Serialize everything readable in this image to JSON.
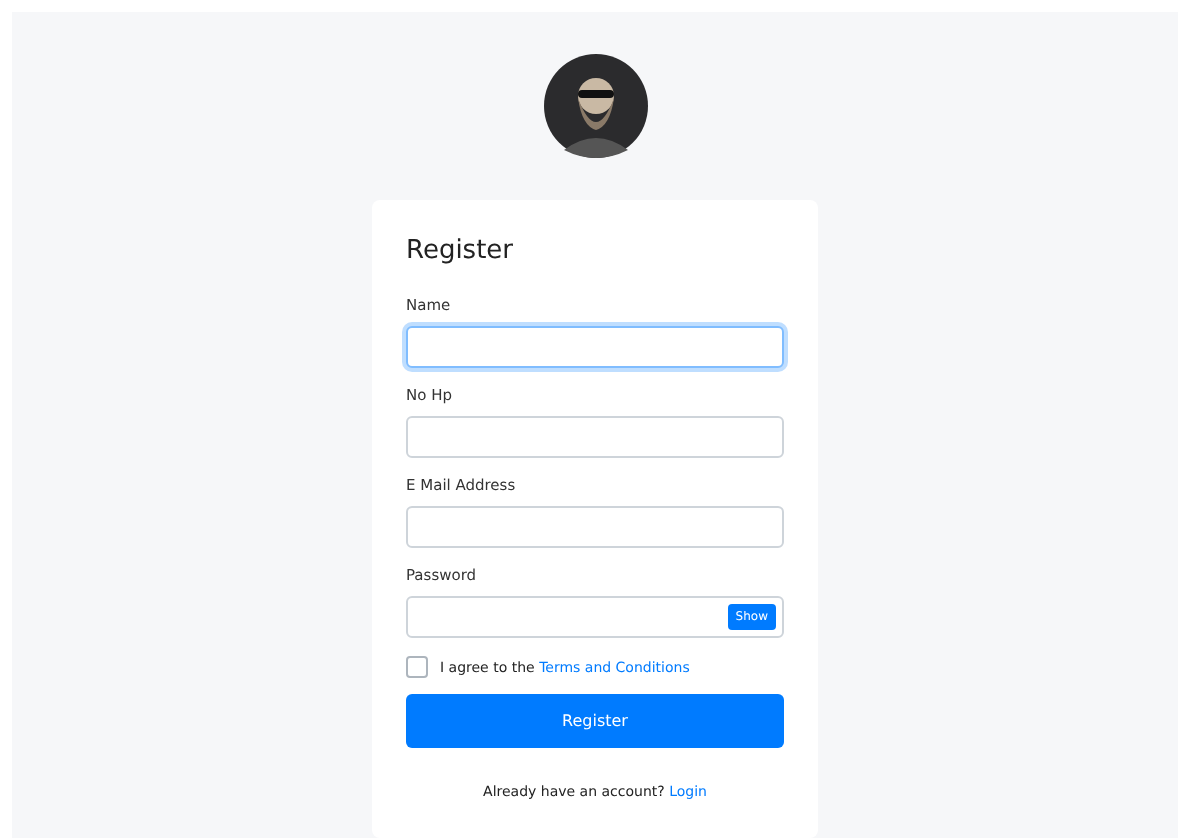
{
  "form": {
    "title": "Register",
    "fields": [
      {
        "label": "Name",
        "focused": true
      },
      {
        "label": "No Hp",
        "focused": false
      },
      {
        "label": "E Mail Address",
        "focused": false
      },
      {
        "label": "Password",
        "focused": false,
        "toggle": "Show"
      }
    ],
    "agree": {
      "checked": false,
      "text": "I agree to the ",
      "link": "Terms and Conditions"
    },
    "submit": "Register",
    "footer": {
      "text": "Already have an account? ",
      "link": "Login"
    }
  }
}
